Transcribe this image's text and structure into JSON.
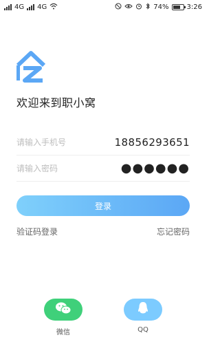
{
  "status_bar": {
    "left_labels": [
      "4G",
      "4G"
    ],
    "battery": "74%",
    "battery_level": 0.74,
    "time": "3:26"
  },
  "app": {
    "welcome": "欢迎来到职小窝",
    "accent": "#5ba7f5"
  },
  "form": {
    "phone": {
      "placeholder": "请输入手机号",
      "value": "18856293651"
    },
    "password": {
      "placeholder": "请输入密码",
      "masked_value": "●●●●●●"
    },
    "login_label": "登录"
  },
  "links": {
    "sms_login": "验证码登录",
    "forgot_password": "忘记密码"
  },
  "social": {
    "wechat_label": "微信",
    "qq_label": "QQ",
    "wechat_color": "#3fd07a",
    "qq_color": "#7ccbff",
    "wechat_icon": "wechat-icon",
    "qq_icon": "qq-icon"
  }
}
